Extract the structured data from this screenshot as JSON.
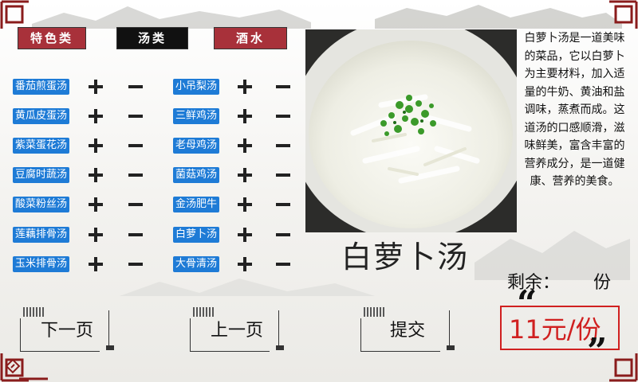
{
  "categories": [
    {
      "label": "特色类",
      "style": "red"
    },
    {
      "label": "汤类",
      "style": "black"
    },
    {
      "label": "酒水",
      "style": "red"
    }
  ],
  "menu_left": [
    "番茄煎蛋汤",
    "黄瓜皮蛋汤",
    "紫菜蛋花汤",
    "豆腐时蔬汤",
    "酸菜粉丝汤",
    "莲藕排骨汤",
    "玉米排骨汤"
  ],
  "menu_right": [
    "小吊梨汤",
    "三鲜鸡汤",
    "老母鸡汤",
    "菌菇鸡汤",
    "金汤肥牛",
    "白萝卜汤",
    "大骨清汤"
  ],
  "description": "白萝卜汤是一道美味的菜品，它以白萝卜为主要材料，加入适量的牛奶、黄油和盐调味，蒸煮而成。这道汤的口感顺滑，滋味鲜美，富含丰富的营养成分，是一道健康、营养的美食。",
  "selected_dish": "白萝卜汤",
  "remaining_label": "剩余：",
  "remaining_unit": "份",
  "price": "11元/份",
  "quote_open": "“",
  "quote_close": "”",
  "buttons": {
    "next": "下一页",
    "prev": "上一页",
    "submit": "提交"
  },
  "colors": {
    "accent_red": "#a8313a",
    "dish_blue": "#1e7bd6",
    "price_red": "#d02020"
  }
}
